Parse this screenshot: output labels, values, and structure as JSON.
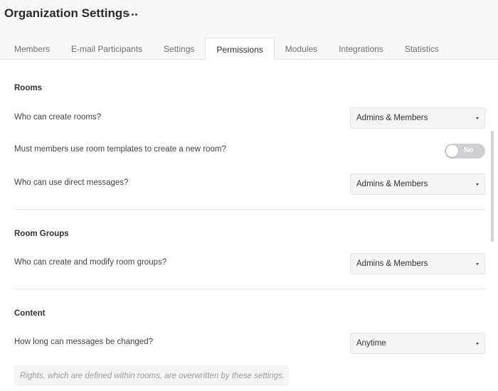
{
  "header": {
    "title": "Organization Settings",
    "more_icon": "more-horizontal-icon"
  },
  "tabs": [
    {
      "label": "Members",
      "active": false
    },
    {
      "label": "E-mail Participants",
      "active": false
    },
    {
      "label": "Settings",
      "active": false
    },
    {
      "label": "Permissions",
      "active": true
    },
    {
      "label": "Modules",
      "active": false
    },
    {
      "label": "Integrations",
      "active": false
    },
    {
      "label": "Statistics",
      "active": false
    }
  ],
  "sections": {
    "rooms": {
      "title": "Rooms",
      "create_rooms": {
        "label": "Who can create rooms?",
        "value": "Admins & Members"
      },
      "room_templates": {
        "label": "Must members use room templates to create a new room?",
        "toggle_label": "No",
        "on": false
      },
      "direct_messages": {
        "label": "Who can use direct messages?",
        "value": "Admins & Members"
      }
    },
    "room_groups": {
      "title": "Room Groups",
      "modify_groups": {
        "label": "Who can create and modify room groups?",
        "value": "Admins & Members"
      }
    },
    "content": {
      "title": "Content",
      "message_change": {
        "label": "How long can messages be changed?",
        "value": "Anytime"
      }
    }
  },
  "note": "Rights, which are defined within rooms, are overwritten by these settings.",
  "colors": {
    "header_bg": "#f7f7f8",
    "select_bg": "#f4f4f5",
    "toggle_off": "#cfcfd3"
  }
}
